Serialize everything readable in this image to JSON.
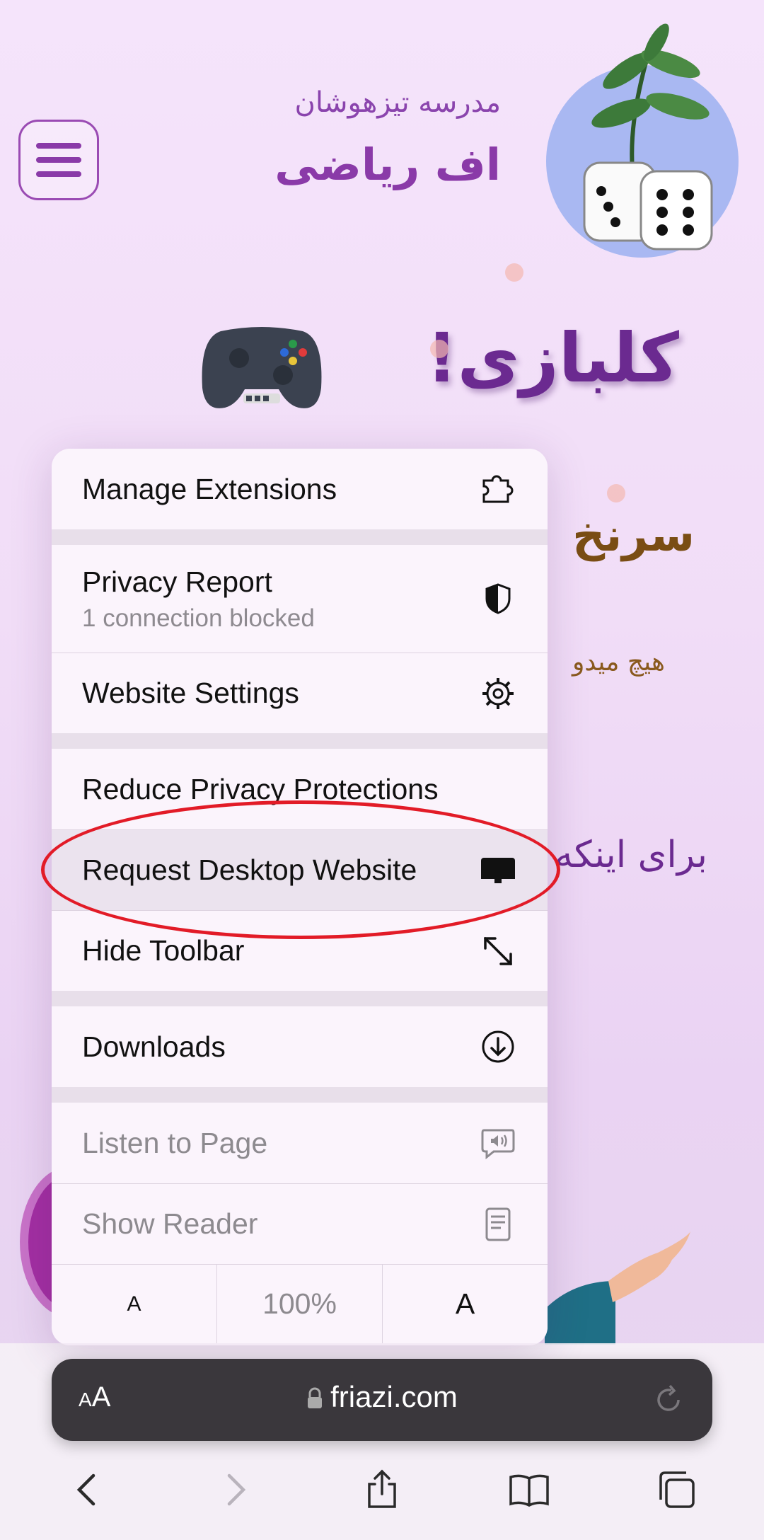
{
  "site": {
    "school_subtitle": "مدرسه تیزهوشان",
    "school_title": "اف ریاضی",
    "headline": "کلبازی!",
    "partial_text_1": "سرنخ",
    "partial_text_2": "هیچ میدو",
    "partial_text_3": "برای اینکه"
  },
  "menu": {
    "items": [
      {
        "label": "Manage Extensions",
        "icon": "puzzle-icon"
      },
      {
        "label": "Privacy Report",
        "sublabel": "1 connection blocked",
        "icon": "shield-icon"
      },
      {
        "label": "Website Settings",
        "icon": "gear-icon"
      },
      {
        "label": "Reduce Privacy Protections"
      },
      {
        "label": "Request Desktop Website",
        "icon": "desktop-icon"
      },
      {
        "label": "Hide Toolbar",
        "icon": "expand-arrows-icon"
      },
      {
        "label": "Downloads",
        "icon": "download-icon"
      },
      {
        "label": "Listen to Page",
        "icon": "speech-bubble-icon"
      },
      {
        "label": "Show Reader",
        "icon": "reader-icon"
      }
    ],
    "zoom": {
      "decrease": "A",
      "level": "100%",
      "increase": "A"
    }
  },
  "toolbar": {
    "aa_small": "A",
    "aa_large": "A",
    "url": "friazi.com"
  },
  "colors": {
    "accent_purple": "#8a3aa8",
    "annotation_red": "#e21b27"
  }
}
